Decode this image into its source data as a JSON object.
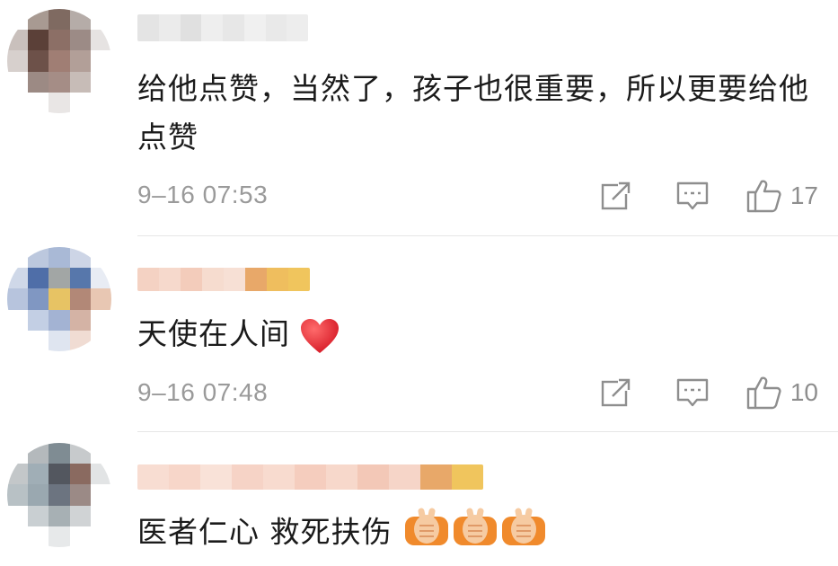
{
  "comments": [
    {
      "text": "给他点赞，当然了，孩子也很重要，所以更要给他点赞",
      "time": "9–16 07:53",
      "likes": "17",
      "avatar_colors": [
        "#ffffff",
        "#a89a92",
        "#7f6a61",
        "#b5aca8",
        "#ffffff",
        "#c9c0bc",
        "#5b4038",
        "#8c6f66",
        "#9c8b86",
        "#e6e3e2",
        "#d7d0cd",
        "#6d5149",
        "#a07e74",
        "#b29f98",
        "#ffffff",
        "#ffffff",
        "#9c8a84",
        "#a58d86",
        "#c7bcb7",
        "#ffffff",
        "#ffffff",
        "#ffffff",
        "#e9e6e5",
        "#ffffff",
        "#ffffff"
      ],
      "name_colors": [
        "#e4e4e4",
        "#ebebeb",
        "#e0e0e0",
        "#eeeeee",
        "#e7e7e7",
        "#f0f0f0",
        "#e9e9e9",
        "#ededed"
      ]
    },
    {
      "text": "天使在人间",
      "time": "9–16 07:48",
      "likes": "10",
      "avatar_colors": [
        "#ffffff",
        "#bcc8de",
        "#a9b9d6",
        "#cdd5e6",
        "#ffffff",
        "#cfd8e8",
        "#4f6ea8",
        "#a2a6a5",
        "#5777ab",
        "#e8ecf4",
        "#b7c4dd",
        "#8097c2",
        "#e7c364",
        "#b28877",
        "#e8c7b3",
        "#ffffff",
        "#c3cfe4",
        "#a3b3d3",
        "#d4b3a5",
        "#ffffff",
        "#ffffff",
        "#ffffff",
        "#dfe5f0",
        "#f0dcd3",
        "#ffffff"
      ],
      "name_colors": [
        "#f4d2c3",
        "#f6d9cc",
        "#f3ccbb",
        "#f6dccf",
        "#f7e0d5",
        "#e8a869",
        "#efbe5e",
        "#f0c55d"
      ]
    },
    {
      "text": "医者仁心 救死扶伤",
      "time": "",
      "likes": "",
      "avatar_colors": [
        "#ffffff",
        "#b4b9bc",
        "#7f8c93",
        "#c7cacc",
        "#ffffff",
        "#c3c7c9",
        "#a0aeb6",
        "#53575f",
        "#8a6a60",
        "#e2e4e5",
        "#b8c1c5",
        "#9aa8b0",
        "#6c7480",
        "#9b8a86",
        "#ffffff",
        "#ffffff",
        "#c9cfd2",
        "#a7b0b4",
        "#d0d3d5",
        "#ffffff",
        "#ffffff",
        "#ffffff",
        "#e7e9ea",
        "#ffffff",
        "#ffffff"
      ],
      "name_colors": [
        "#f8ddd2",
        "#f7d6c9",
        "#f9e2d8",
        "#f6d3c6",
        "#f8dbcf",
        "#f5cdbe",
        "#f7d8cb",
        "#f3c8b7",
        "#f6d5c8",
        "#e8a869",
        "#f0c55d"
      ]
    }
  ],
  "icons": {
    "share": "share-icon",
    "reply": "comment-icon",
    "like": "thumbs-up-icon",
    "heart": "red-heart-emoji",
    "praying": "praying-hands-emoji"
  },
  "colors": {
    "meta_gray": "#9a9a9a",
    "icon_gray": "#8e8e8e",
    "heart_red": "#e8333c",
    "emoji_orange": "#f08a2c"
  }
}
